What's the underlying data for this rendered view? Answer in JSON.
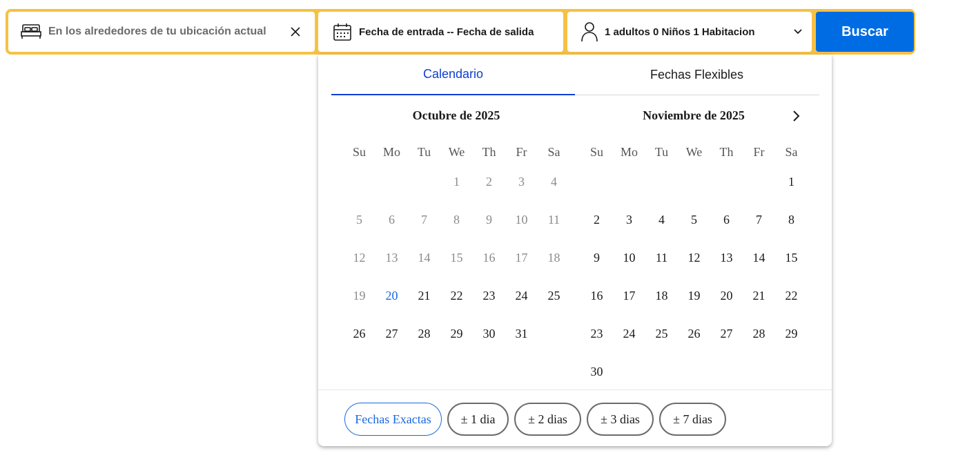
{
  "search": {
    "destination_value": "En los alrededores de tu ubicación actual",
    "dates_value": "Fecha de entrada -- Fecha de salida",
    "guests_value": "1 adultos 0 Niños 1 Habitacion",
    "search_button": "Buscar"
  },
  "calendar": {
    "tabs": [
      "Calendario",
      "Fechas Flexibles"
    ],
    "active_tab": "Calendario",
    "weekdays": [
      "Su",
      "Mo",
      "Tu",
      "We",
      "Th",
      "Fr",
      "Sa"
    ],
    "months": [
      {
        "title": "Octubre de 2025",
        "weeks": [
          [
            "",
            "",
            "",
            "1",
            "2",
            "3",
            "4"
          ],
          [
            "5",
            "6",
            "7",
            "8",
            "9",
            "10",
            "11"
          ],
          [
            "12",
            "13",
            "14",
            "15",
            "16",
            "17",
            "18"
          ],
          [
            "19",
            "20",
            "21",
            "22",
            "23",
            "24",
            "25"
          ],
          [
            "26",
            "27",
            "28",
            "29",
            "30",
            "31",
            ""
          ]
        ],
        "past_through": 19,
        "today": "20"
      },
      {
        "title": "Noviembre de 2025",
        "weeks": [
          [
            "",
            "",
            "",
            "",
            "",
            "",
            "1"
          ],
          [
            "2",
            "3",
            "4",
            "5",
            "6",
            "7",
            "8"
          ],
          [
            "9",
            "10",
            "11",
            "12",
            "13",
            "14",
            "15"
          ],
          [
            "16",
            "17",
            "18",
            "19",
            "20",
            "21",
            "22"
          ],
          [
            "23",
            "24",
            "25",
            "26",
            "27",
            "28",
            "29"
          ],
          [
            "30",
            "",
            "",
            "",
            "",
            "",
            ""
          ]
        ]
      }
    ],
    "flex_chips": [
      "Fechas Exactas",
      "± 1 dia",
      "± 2 dias",
      "± 3 dias",
      "± 7 dias"
    ],
    "active_chip": "Fechas Exactas"
  },
  "colors": {
    "searchbar_border": "#f6c143",
    "primary_button": "#006ce4",
    "active_tab": "#0d3fd1",
    "today": "#1668e3"
  },
  "icons": [
    "bed-icon",
    "close-icon",
    "calendar-icon",
    "person-icon",
    "chevron-down-icon",
    "chevron-right-icon"
  ]
}
